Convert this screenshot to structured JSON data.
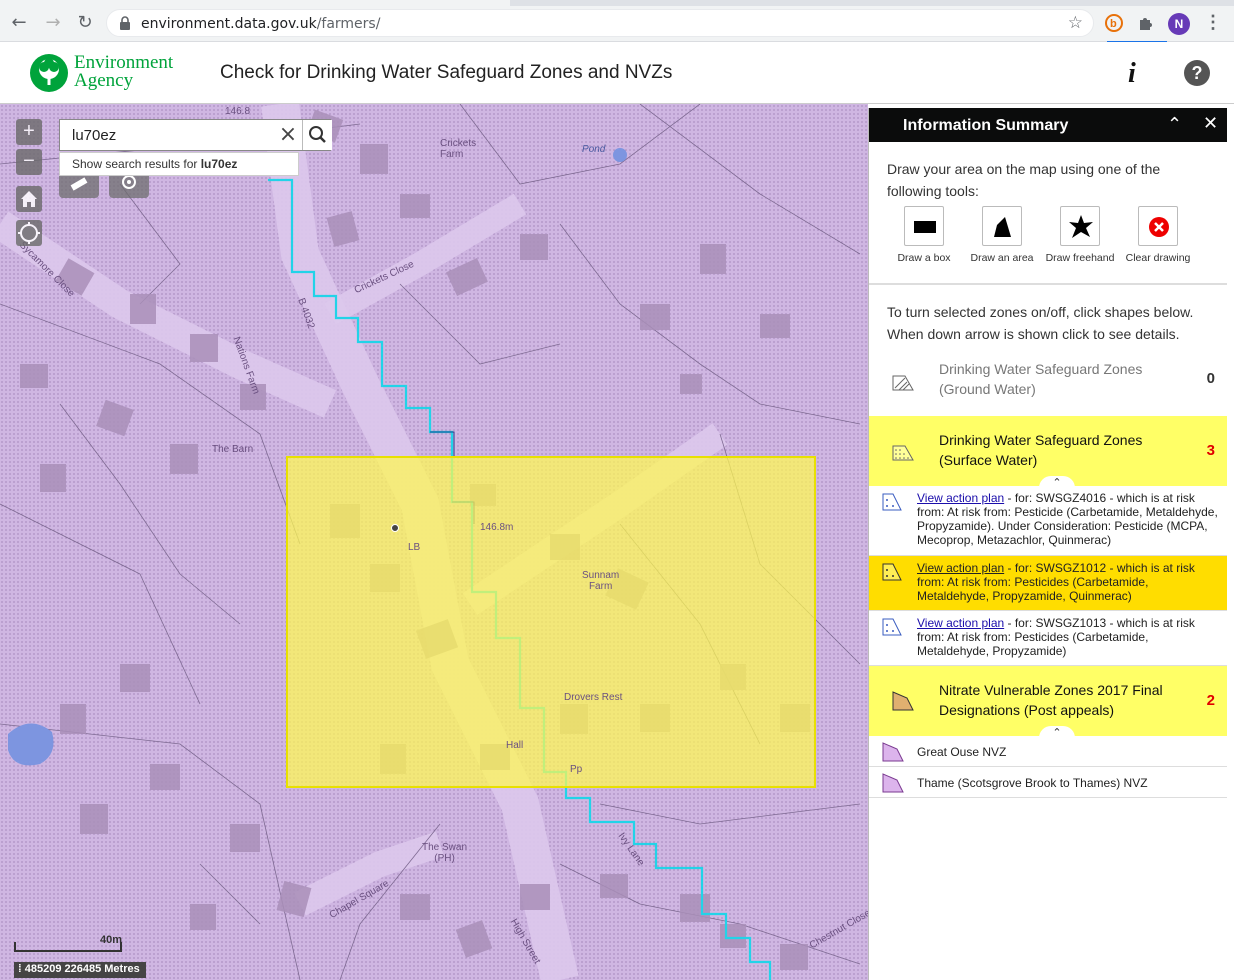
{
  "browser": {
    "url_domain": "environment.data.gov.uk",
    "url_path": "/farmers/",
    "avatar_letter": "N"
  },
  "header": {
    "logo_line1": "Environment",
    "logo_line2": "Agency",
    "title": "Check for Drinking Water Safeguard Zones and NVZs"
  },
  "search": {
    "value": "lu70ez",
    "suggest_prefix": "Show search results for ",
    "suggest_term": "lu70ez"
  },
  "map": {
    "scale_label": "40m",
    "coordinates": "485209 226485 Metres",
    "labels": {
      "crickets_farm": "Crickets\nFarm",
      "pond": "Pond",
      "crickets_close": "Crickets Close",
      "sycamore_close": "Sycamore Close",
      "b4032": "B 4032",
      "nations_farm": "Nations Farm",
      "the_barn": "The Barn",
      "lb": "LB",
      "height": "146.8m",
      "sunnam_farm": "Sunnam\nFarm",
      "drovers_rest": "Drovers Rest",
      "pump": "Pp",
      "hall": "Hall",
      "the_swan": "The Swan\n(PH)",
      "chapel_square": "Chapel Square",
      "ivy_lane": "Ivy Lane",
      "high_street": "High Street",
      "chestnut_close": "Chestnut Close",
      "top_height": "146.8"
    }
  },
  "panel": {
    "title": "Information Summary",
    "intro": "Draw your area on the map using one of the following tools:",
    "tools": [
      {
        "label": "Draw a box"
      },
      {
        "label": "Draw an area"
      },
      {
        "label": "Draw freehand"
      },
      {
        "label": "Clear drawing"
      }
    ],
    "note": "To turn selected zones on/off, click shapes below. When down arrow is shown click to see details.",
    "layers": {
      "groundwater": {
        "name_line1": "Drinking Water Safeguard Zones",
        "name_line2": "(Ground Water)",
        "count": "0"
      },
      "surface": {
        "name_line1": "Drinking Water Safeguard Zones",
        "name_line2": "(Surface Water)",
        "count": "3"
      },
      "nvz": {
        "name_line1": "Nitrate Vulnerable Zones 2017 Final",
        "name_line2": "Designations (Post appeals)",
        "count": "2"
      }
    },
    "surface_rows": [
      {
        "link": "View action plan",
        "text": " - for: SWSGZ4016 - which is at risk from: At risk from: Pesticide (Carbetamide, Metaldehyde, Propyzamide). Under Consideration: Pesticide (MCPA, Mecoprop, Metazachlor, Quinmerac)"
      },
      {
        "link": "View action plan",
        "text": " - for: SWSGZ1012 - which is at risk from: At risk from: Pesticides (Carbetamide, Metaldehyde, Propyzamide, Quinmerac)"
      },
      {
        "link": "View action plan",
        "text": " - for: SWSGZ1013 - which is at risk from: At risk from: Pesticides (Carbetamide, Metaldehyde, Propyzamide)"
      }
    ],
    "nvz_rows": [
      {
        "name": "Great Ouse NVZ"
      },
      {
        "name": "Thame (Scotsgrove Brook to Thames) NVZ"
      }
    ]
  },
  "colors": {
    "accent_green": "#00a33b",
    "map_fill": "#cfb6e2",
    "selection_yellow": "#ffff66",
    "highlight_row": "#ffdd00",
    "count_red": "#e00000"
  }
}
